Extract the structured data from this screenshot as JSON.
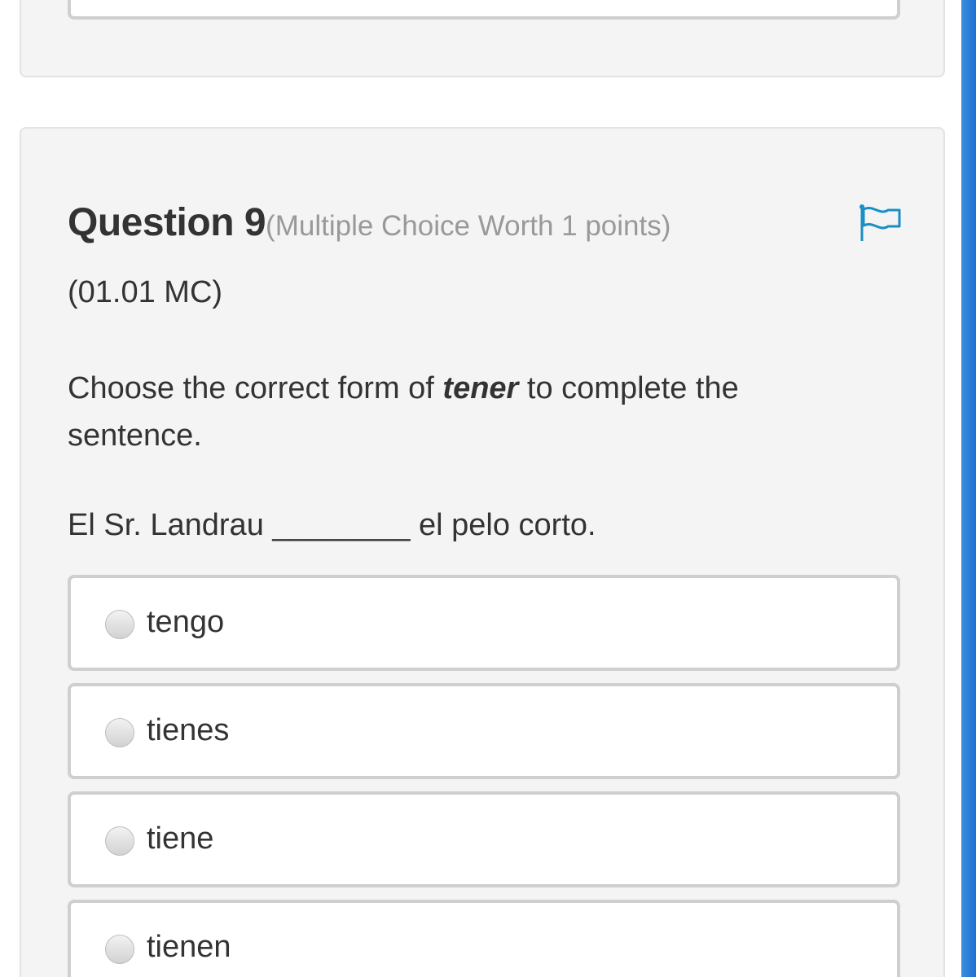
{
  "question": {
    "title": "Question 9",
    "meta": "(Multiple Choice Worth 1 points)",
    "code": "(01.01 MC)",
    "prompt_before": "Choose the correct form of ",
    "prompt_emphasis": "tener",
    "prompt_after": " to complete the sentence.",
    "sentence": "El Sr. Landrau ________ el pelo corto."
  },
  "flag_icon": "flag-outline-icon",
  "accent_color": "#1a8fc4",
  "options": [
    {
      "label": "tengo",
      "selected": false
    },
    {
      "label": "tienes",
      "selected": false
    },
    {
      "label": "tiene",
      "selected": false
    },
    {
      "label": "tienen",
      "selected": false
    }
  ]
}
